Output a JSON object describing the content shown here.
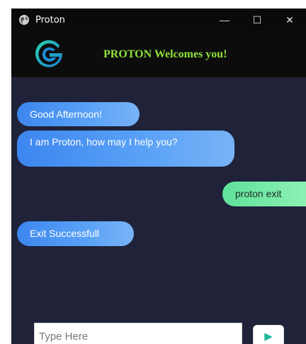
{
  "window": {
    "title": "Proton",
    "controls": {
      "minimize": "—",
      "maximize": "☐",
      "close": "✕"
    }
  },
  "header": {
    "logo": "proton-g-logo",
    "welcome_text": "PROTON Welcomes you!"
  },
  "messages": [
    {
      "sender": "bot",
      "text": "Good Afternoon!"
    },
    {
      "sender": "bot",
      "text": "I am Proton, how may I help you?"
    },
    {
      "sender": "user",
      "text": "proton exit"
    },
    {
      "sender": "bot",
      "text": "Exit Successfull"
    }
  ],
  "input": {
    "placeholder": "Type Here",
    "value": ""
  },
  "send_button": {
    "icon": "send-triangle-icon",
    "glyph": "▶"
  },
  "colors": {
    "chat_background": "#1f2238",
    "header_background": "#0c0c0c",
    "welcome_text": "#8ee03a",
    "bot_bubble": "#4a90ee",
    "user_bubble": "#6ee8a4",
    "send_arrow": "#1fb89a"
  }
}
